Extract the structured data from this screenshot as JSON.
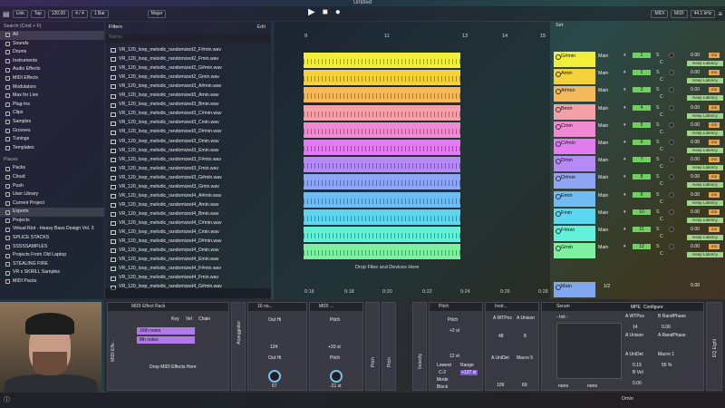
{
  "window": {
    "title": "Untitled"
  },
  "topbar": {
    "items": [
      "Link",
      "Tap",
      "120.00",
      "4 / 4",
      "1 Bar",
      "Major"
    ],
    "right": [
      "MIDI",
      "MIDI",
      "44.1 kHz"
    ]
  },
  "browser": {
    "search_placeholder": "Search (Cmd + F)",
    "categories": [
      "All",
      "Sounds",
      "Drums",
      "Instruments",
      "Audio Effects",
      "MIDI Effects",
      "Modulators",
      "Max for Live",
      "Plug-Ins",
      "Clips",
      "Samples",
      "Grooves",
      "Tunings",
      "Templates"
    ],
    "places_label": "Places",
    "places": [
      "Packs",
      "Cloud",
      "Push",
      "User Library",
      "Current Project",
      "Exports",
      "Projects",
      "Virtual Riot - Heavy Bass Design Vol. 3",
      "SPLICE STACKS",
      "SSSSSAMPLES",
      "Projects From Old Laptop",
      "STEALING FIRE",
      "VR x SKRILL Samples",
      "MIDI Packs"
    ]
  },
  "files": {
    "filters_label": "Filters",
    "edit_label": "Edit",
    "column_name": "Name",
    "items": [
      "VR_120_loop_melodic_randomized2_F#min.wav",
      "VR_120_loop_melodic_randomized2_Fmin.wav",
      "VR_120_loop_melodic_randomized2_G#min.wav",
      "VR_120_loop_melodic_randomized2_Gmin.wav",
      "VR_120_loop_melodic_randomized3_A#min.wav",
      "VR_120_loop_melodic_randomized3_Amin.wav",
      "VR_120_loop_melodic_randomized3_Bmin.wav",
      "VR_120_loop_melodic_randomized3_C#min.wav",
      "VR_120_loop_melodic_randomized3_Cmin.wav",
      "VR_120_loop_melodic_randomized3_D#min.wav",
      "VR_120_loop_melodic_randomized3_Dmin.wav",
      "VR_120_loop_melodic_randomized3_Emin.wav",
      "VR_120_loop_melodic_randomized3_F#min.wav",
      "VR_120_loop_melodic_randomized3_Fmin.wav",
      "VR_120_loop_melodic_randomized3_G#min.wav",
      "VR_120_loop_melodic_randomized3_Gmin.wav",
      "VR_120_loop_melodic_randomized4_A#min.wav",
      "VR_120_loop_melodic_randomized4_Amin.wav",
      "VR_120_loop_melodic_randomized4_Bmin.wav",
      "VR_120_loop_melodic_randomized4_C#min.wav",
      "VR_120_loop_melodic_randomized4_Cmin.wav",
      "VR_120_loop_melodic_randomized4_D#min.wav",
      "VR_120_loop_melodic_randomized4_Dmin.wav",
      "VR_120_loop_melodic_randomized4_Emin.wav",
      "VR_120_loop_melodic_randomized4_F#min.wav",
      "VR_120_loop_melodic_randomized4_Fmin.wav",
      "VR_120_loop_melodic_randomized4_G#min.wav"
    ]
  },
  "arrangement": {
    "ruler": [
      "9",
      "11",
      "13",
      "14",
      "15"
    ],
    "times": [
      "0:16",
      "0:18",
      "0:20",
      "0:22",
      "0:24",
      "0:26",
      "0:28"
    ],
    "drop_text": "Drop Files and Devices Here",
    "clip_colors": [
      "#f2ef3a",
      "#f4d23c",
      "#f5b85a",
      "#f5a0a8",
      "#f08ad2",
      "#e27cf0",
      "#b58af5",
      "#8ea6f5",
      "#6fbdf2",
      "#5fd6f0",
      "#62f0d8",
      "#7ff0a0"
    ]
  },
  "mixer": {
    "set_label": "Set",
    "tracks": [
      {
        "name": "G#min",
        "color": "#f2ef3a",
        "route": "Main",
        "num": "1"
      },
      {
        "name": "Amin",
        "color": "#f4d23c",
        "route": "Main",
        "num": "2"
      },
      {
        "name": "A#min",
        "color": "#f5b85a",
        "route": "Main",
        "num": "3"
      },
      {
        "name": "Bmin",
        "color": "#f5a0a8",
        "route": "Main",
        "num": "4"
      },
      {
        "name": "Cmin",
        "color": "#f08ad2",
        "route": "Main",
        "num": "5"
      },
      {
        "name": "C#min",
        "color": "#e27cf0",
        "route": "Main",
        "num": "6"
      },
      {
        "name": "Dmin",
        "color": "#b58af5",
        "route": "Main",
        "num": "7"
      },
      {
        "name": "D#min",
        "color": "#8ea6f5",
        "route": "Main",
        "num": "8"
      },
      {
        "name": "Emin",
        "color": "#6fbdf2",
        "route": "Main",
        "num": "9"
      },
      {
        "name": "Fmin",
        "color": "#5fd6f0",
        "route": "Main",
        "num": "10"
      },
      {
        "name": "F#min",
        "color": "#62f0d8",
        "route": "Main",
        "num": "11"
      },
      {
        "name": "Gmin",
        "color": "#7ff0a0",
        "route": "Main",
        "num": "12"
      }
    ],
    "s_label": "S",
    "c_label": "C",
    "vol": "0.00",
    "ms_label": "ms",
    "keep_latency": "Keep Latency",
    "master": {
      "name": "Main",
      "fraction": "1/2",
      "vol": "0.00"
    }
  },
  "devices": {
    "midi_rack": {
      "title": "MIDI Effect Rack",
      "cols": [
        "Key",
        "Vel",
        "Chain"
      ],
      "chains": [
        "16th notes",
        "8th notes"
      ],
      "drop": "Drop MIDI Effects Here",
      "side": "MIDI Effe..."
    },
    "arp": {
      "title": "Arpeggiator"
    },
    "d2": {
      "title": "16 no...",
      "labels": [
        "Out Hi",
        "124",
        "Out Hi",
        "67"
      ]
    },
    "d3": {
      "title": "MIDI ...",
      "labels": [
        "Pitch",
        "+33 st",
        "Pitch",
        "-21 st"
      ]
    },
    "pitch1": {
      "title": "Pitch"
    },
    "pitch2": {
      "title": "Pitch"
    },
    "velocity": {
      "title": "Velocity"
    },
    "pitch3": {
      "title": "Pitch",
      "labels": [
        "Pitch",
        "+2 st",
        "12 st",
        "Lowest",
        "C-2",
        "Range",
        "+127 st",
        "Mode",
        "Block"
      ]
    },
    "instr": {
      "title": "Instr...",
      "labels": [
        "A WTPos",
        "A Unison",
        "48",
        "8",
        "A UniDet",
        "Macro 5",
        "109",
        "69"
      ]
    },
    "serum": {
      "title": "Serum",
      "preset": "- Init -",
      "mpe": "MPE",
      "configure": "Configure",
      "params": [
        "A WTPos",
        "B RandPhase",
        "A Unison",
        "A RandPhase",
        "A UniDet",
        "Macro 1",
        "B Vol"
      ],
      "values": [
        "14",
        "0.00",
        "0.19",
        "55 %",
        "0.00"
      ],
      "none1": "none",
      "none2": "none"
    },
    "eq": {
      "title": "EQ Eight"
    }
  },
  "status": {
    "track": "Dmin"
  }
}
